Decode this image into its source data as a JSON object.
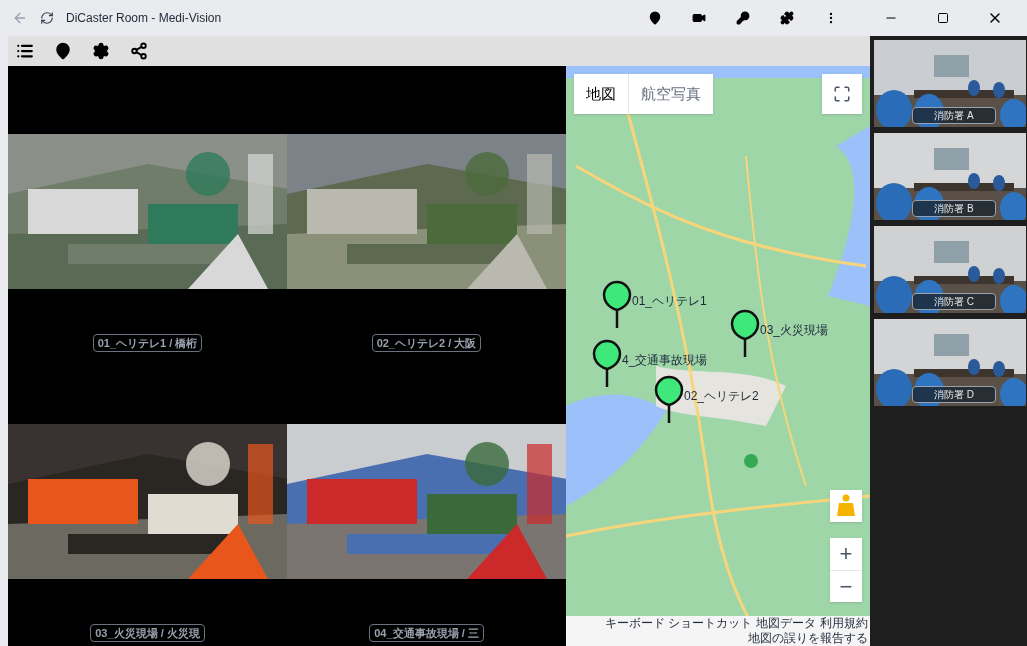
{
  "window": {
    "title": "DiCaster Room - Medi-Vision"
  },
  "videos": [
    {
      "label": "01_ヘリテレ1 / 橋桁"
    },
    {
      "label": "02_ヘリテレ2 / 大阪"
    },
    {
      "label": "03_火災現場 / 火災現"
    },
    {
      "label": "04_交通事故現場 / 三"
    }
  ],
  "map": {
    "view_tabs": [
      {
        "label": "地図",
        "selected": true
      },
      {
        "label": "航空写真",
        "selected": false
      }
    ],
    "markers": [
      {
        "label": "01_ヘリテレ1"
      },
      {
        "label": "03_火災現場"
      },
      {
        "label": "4_交通事故現場"
      },
      {
        "label": "02_ヘリテレ2"
      }
    ],
    "zoom_in": "+",
    "zoom_out": "−",
    "attribution": [
      "キーボード ショートカット",
      "地図データ",
      "利用規約",
      "地図の誤りを報告する"
    ]
  },
  "participants": [
    {
      "label": "消防署 A"
    },
    {
      "label": "消防署 B"
    },
    {
      "label": "消防署 C"
    },
    {
      "label": "消防署 D"
    }
  ]
}
